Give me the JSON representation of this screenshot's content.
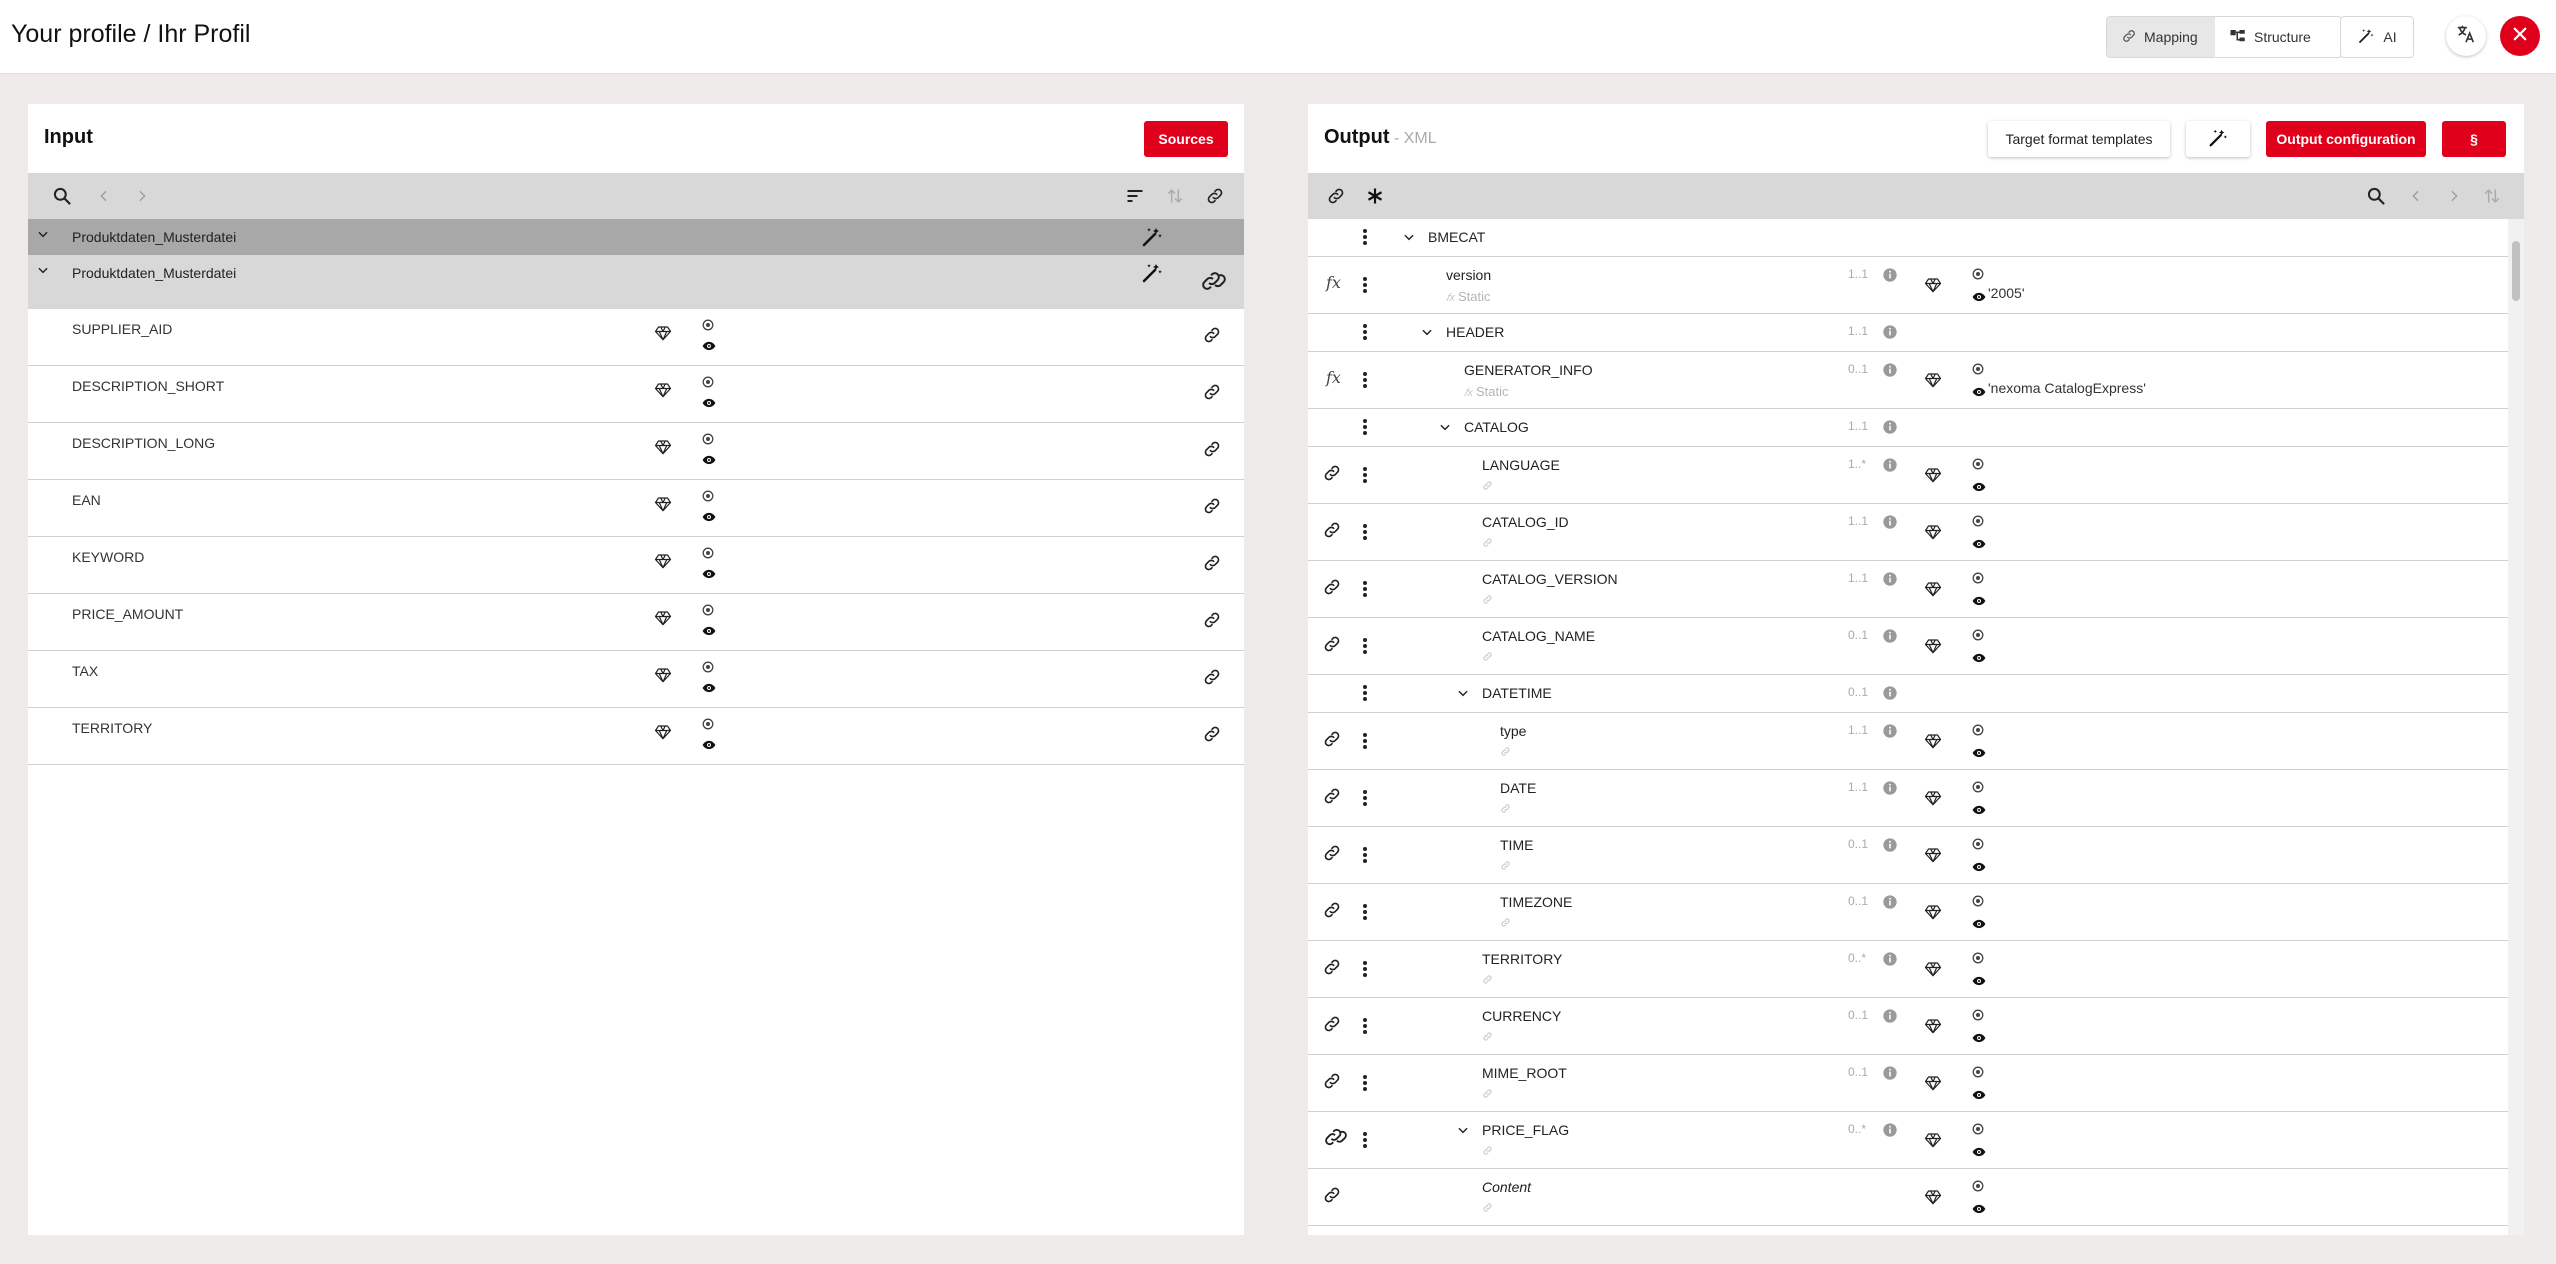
{
  "page_title": "Your profile / Ihr Profil",
  "view_toggle": {
    "mapping": "Mapping",
    "structure": "Structure",
    "active": "mapping"
  },
  "ai_label": "AI",
  "colors": {
    "accent": "#e0001b",
    "toolbar": "#d8d8d8",
    "group_dark": "#a8a8a8"
  },
  "input": {
    "title": "Input",
    "sources_label": "Sources",
    "groups": [
      "Produktdaten_Musterdatei",
      "Produktdaten_Musterdatei"
    ],
    "fields": [
      "SUPPLIER_AID",
      "DESCRIPTION_SHORT",
      "DESCRIPTION_LONG",
      "EAN",
      "KEYWORD",
      "PRICE_AMOUNT",
      "TAX",
      "TERRITORY"
    ]
  },
  "output": {
    "title": "Output",
    "format": " - XML",
    "target_templates_label": "Target format templates",
    "output_config_label": "Output configuration",
    "paragraph_label": "§",
    "rows": [
      {
        "name": "BMECAT",
        "card": "",
        "sub": "",
        "value": ""
      },
      {
        "name": "version",
        "card": "1..1",
        "sub": "Static",
        "value": "'2005'"
      },
      {
        "name": "HEADER",
        "card": "1..1",
        "sub": "",
        "value": ""
      },
      {
        "name": "GENERATOR_INFO",
        "card": "0..1",
        "sub": "Static",
        "value": "'nexoma CatalogExpress'"
      },
      {
        "name": "CATALOG",
        "card": "1..1",
        "sub": "",
        "value": ""
      },
      {
        "name": "LANGUAGE",
        "card": "1..*",
        "sub": "",
        "value": ""
      },
      {
        "name": "CATALOG_ID",
        "card": "1..1",
        "sub": "",
        "value": ""
      },
      {
        "name": "CATALOG_VERSION",
        "card": "1..1",
        "sub": "",
        "value": ""
      },
      {
        "name": "CATALOG_NAME",
        "card": "0..1",
        "sub": "",
        "value": ""
      },
      {
        "name": "DATETIME",
        "card": "0..1",
        "sub": "",
        "value": ""
      },
      {
        "name": "type",
        "card": "1..1",
        "sub": "",
        "value": ""
      },
      {
        "name": "DATE",
        "card": "1..1",
        "sub": "",
        "value": ""
      },
      {
        "name": "TIME",
        "card": "0..1",
        "sub": "",
        "value": ""
      },
      {
        "name": "TIMEZONE",
        "card": "0..1",
        "sub": "",
        "value": ""
      },
      {
        "name": "TERRITORY",
        "card": "0..*",
        "sub": "",
        "value": ""
      },
      {
        "name": "CURRENCY",
        "card": "0..1",
        "sub": "",
        "value": ""
      },
      {
        "name": "MIME_ROOT",
        "card": "0..1",
        "sub": "",
        "value": ""
      },
      {
        "name": "PRICE_FLAG",
        "card": "0..*",
        "sub": "",
        "value": ""
      },
      {
        "name": "Content",
        "card": "",
        "sub": "",
        "value": ""
      }
    ]
  }
}
